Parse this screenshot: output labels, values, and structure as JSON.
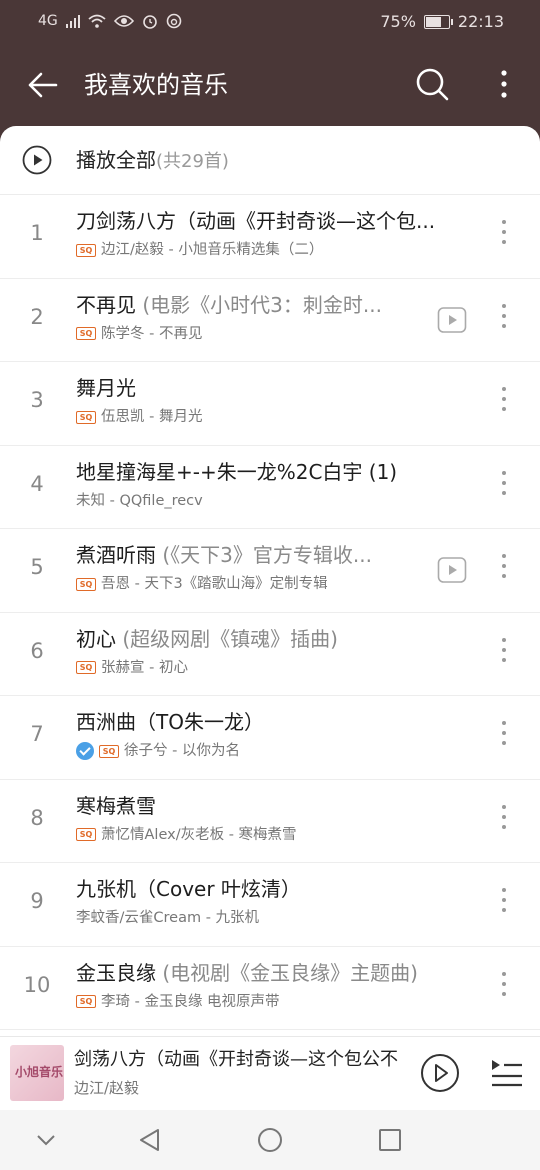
{
  "status_bar": {
    "network": "4G",
    "battery": "75%",
    "time": "22:13"
  },
  "appbar": {
    "title": "我喜欢的音乐"
  },
  "play_all": {
    "label": "播放全部",
    "count": "(共29首)"
  },
  "songs": [
    {
      "index": "1",
      "title": "刀剑荡八方（动画《开封奇谈—这个包...",
      "subtitle": "",
      "sq": true,
      "verified": false,
      "meta": "边江/赵毅 - 小旭音乐精选集（二）",
      "mv": false
    },
    {
      "index": "2",
      "title": "不再见 ",
      "subtitle": "(电影《小时代3：刺金时...",
      "sq": true,
      "verified": false,
      "meta": "陈学冬 - 不再见",
      "mv": true
    },
    {
      "index": "3",
      "title": "舞月光",
      "subtitle": "",
      "sq": true,
      "verified": false,
      "meta": "伍思凯 - 舞月光",
      "mv": false
    },
    {
      "index": "4",
      "title": "地星撞海星+-+朱一龙%2C白宇 (1)",
      "subtitle": "",
      "sq": false,
      "verified": false,
      "meta": "未知 - QQfile_recv",
      "mv": false
    },
    {
      "index": "5",
      "title": "煮酒听雨 ",
      "subtitle": "(《天下3》官方专辑收...",
      "sq": true,
      "verified": false,
      "meta": "吾恩 - 天下3《踏歌山海》定制专辑",
      "mv": true
    },
    {
      "index": "6",
      "title": "初心 ",
      "subtitle": "(超级网剧《镇魂》插曲)",
      "sq": true,
      "verified": false,
      "meta": "张赫宣 - 初心",
      "mv": false
    },
    {
      "index": "7",
      "title": "西洲曲（TO朱一龙）",
      "subtitle": "",
      "sq": true,
      "verified": true,
      "meta": "徐子兮 - 以你为名",
      "mv": false
    },
    {
      "index": "8",
      "title": "寒梅煮雪",
      "subtitle": "",
      "sq": true,
      "verified": false,
      "meta": "萧忆情Alex/灰老板 - 寒梅煮雪",
      "mv": false
    },
    {
      "index": "9",
      "title": "九张机（Cover 叶炫清）",
      "subtitle": "",
      "sq": false,
      "verified": false,
      "meta": "李蚊香/云雀Cream - 九张机",
      "mv": false
    },
    {
      "index": "10",
      "title": "金玉良缘 ",
      "subtitle": "(电视剧《金玉良缘》主题曲)",
      "sq": true,
      "verified": false,
      "meta": "李琦 - 金玉良缘 电视原声带",
      "mv": false
    }
  ],
  "sq_badge": "SQ",
  "now_playing": {
    "title": "剑荡八方（动画《开封奇谈—这个包公不",
    "artist": "边江/赵毅",
    "cover_text": "小旭音乐"
  },
  "colors": {
    "header_bg": "#4a3737",
    "sq_badge": "#e06a28",
    "verified": "#4aa0e6"
  }
}
